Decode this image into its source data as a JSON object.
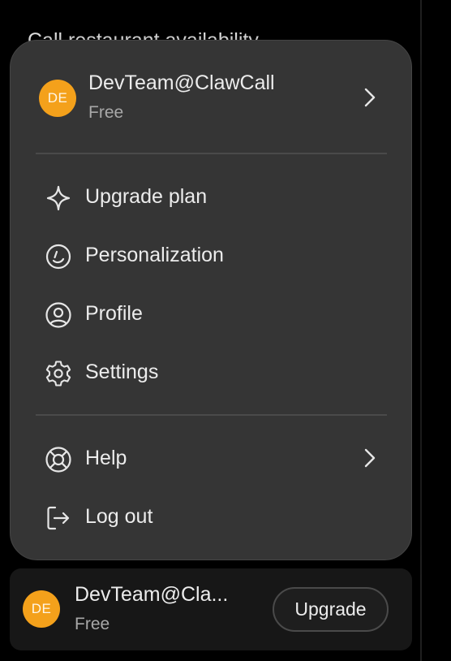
{
  "background_text": "Call restaurant availability",
  "account": {
    "avatar_initials": "DE",
    "name": "DevTeam@ClawCall",
    "plan": "Free"
  },
  "menu_items": [
    {
      "label": "Upgrade plan",
      "icon": "sparkle-icon"
    },
    {
      "label": "Personalization",
      "icon": "smiley-icon"
    },
    {
      "label": "Profile",
      "icon": "user-circle-icon"
    },
    {
      "label": "Settings",
      "icon": "gear-icon"
    },
    {
      "label": "Help",
      "icon": "lifebuoy-icon"
    },
    {
      "label": "Log out",
      "icon": "logout-icon"
    }
  ],
  "bottom_bar": {
    "avatar_initials": "DE",
    "name": "DevTeam@Cla...",
    "plan": "Free",
    "upgrade_label": "Upgrade"
  },
  "colors": {
    "avatar": "#f4a11b",
    "menu_background": "#353535",
    "page_background": "#000000"
  }
}
